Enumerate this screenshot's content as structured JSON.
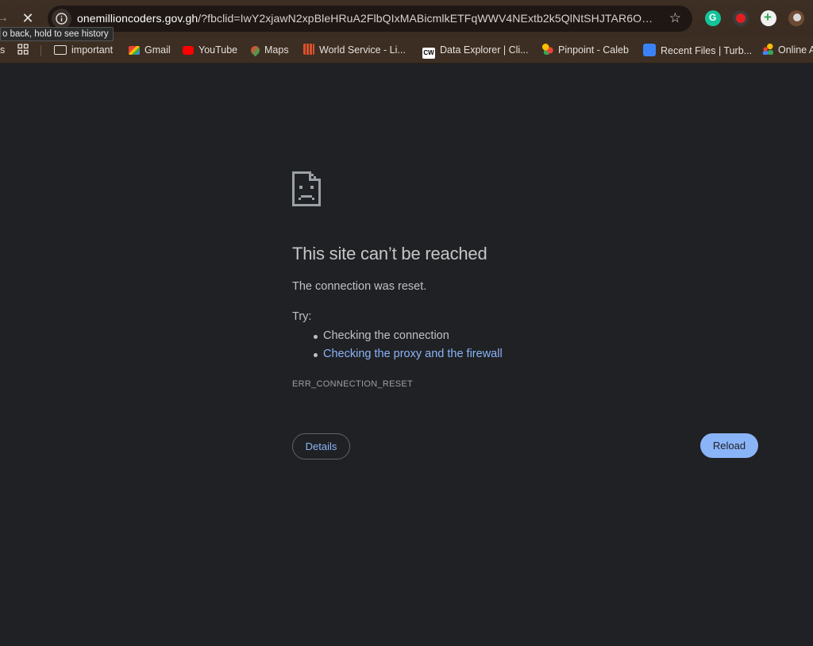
{
  "browser": {
    "tooltip": "o back, hold to see history",
    "url_host": "onemillioncoders.gov.gh",
    "url_rest": "/?fbclid=IwY2xjawN2xpBleHRuA2FlbQIxMABicmlkETFqWWV4NExtb2k5QlNtSHJTAR6O…",
    "extensions": [
      "grammarly-icon",
      "record-icon",
      "add-icon",
      "extension-icon"
    ]
  },
  "bookmarks": [
    {
      "label": "s",
      "icon": "cut-off"
    },
    {
      "label": "",
      "icon": "apps-grid-icon"
    },
    {
      "label": "important",
      "icon": "folder-icon"
    },
    {
      "label": "Gmail",
      "icon": "gmail-icon"
    },
    {
      "label": "YouTube",
      "icon": "youtube-icon"
    },
    {
      "label": "Maps",
      "icon": "maps-icon"
    },
    {
      "label": "World Service - Li...",
      "icon": "bbc-icon"
    },
    {
      "label": "Data Explorer | Cli...",
      "icon": "cw-icon"
    },
    {
      "label": "Pinpoint - Caleb",
      "icon": "pinpoint-icon"
    },
    {
      "label": "Recent Files | Turb...",
      "icon": "turbo-icon"
    },
    {
      "label": "Online A",
      "icon": "online-icon"
    }
  ],
  "error": {
    "title": "This site can’t be reached",
    "description": "The connection was reset.",
    "try_label": "Try:",
    "suggestions": [
      "Checking the connection",
      "Checking the proxy and the firewall"
    ],
    "code": "ERR_CONNECTION_RESET",
    "details_label": "Details",
    "reload_label": "Reload"
  },
  "colors": {
    "chrome": "#3c2e22",
    "page_bg": "#202124",
    "accent": "#8ab4f8"
  }
}
